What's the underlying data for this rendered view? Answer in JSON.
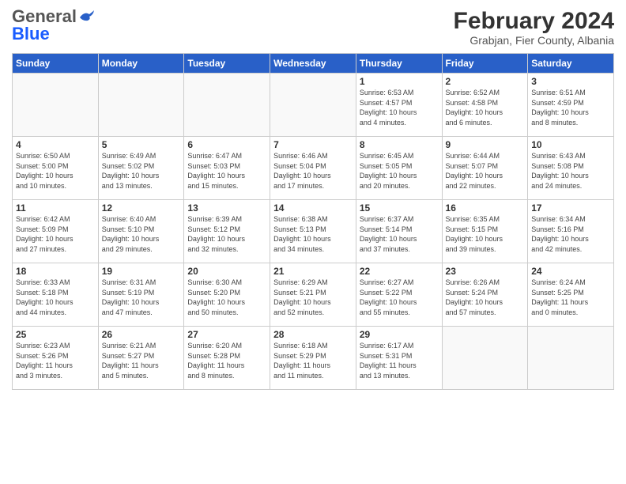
{
  "header": {
    "logo_general": "General",
    "logo_blue": "Blue",
    "title": "February 2024",
    "location": "Grabjan, Fier County, Albania"
  },
  "days_of_week": [
    "Sunday",
    "Monday",
    "Tuesday",
    "Wednesday",
    "Thursday",
    "Friday",
    "Saturday"
  ],
  "weeks": [
    [
      {
        "day": "",
        "info": ""
      },
      {
        "day": "",
        "info": ""
      },
      {
        "day": "",
        "info": ""
      },
      {
        "day": "",
        "info": ""
      },
      {
        "day": "1",
        "info": "Sunrise: 6:53 AM\nSunset: 4:57 PM\nDaylight: 10 hours\nand 4 minutes."
      },
      {
        "day": "2",
        "info": "Sunrise: 6:52 AM\nSunset: 4:58 PM\nDaylight: 10 hours\nand 6 minutes."
      },
      {
        "day": "3",
        "info": "Sunrise: 6:51 AM\nSunset: 4:59 PM\nDaylight: 10 hours\nand 8 minutes."
      }
    ],
    [
      {
        "day": "4",
        "info": "Sunrise: 6:50 AM\nSunset: 5:00 PM\nDaylight: 10 hours\nand 10 minutes."
      },
      {
        "day": "5",
        "info": "Sunrise: 6:49 AM\nSunset: 5:02 PM\nDaylight: 10 hours\nand 13 minutes."
      },
      {
        "day": "6",
        "info": "Sunrise: 6:47 AM\nSunset: 5:03 PM\nDaylight: 10 hours\nand 15 minutes."
      },
      {
        "day": "7",
        "info": "Sunrise: 6:46 AM\nSunset: 5:04 PM\nDaylight: 10 hours\nand 17 minutes."
      },
      {
        "day": "8",
        "info": "Sunrise: 6:45 AM\nSunset: 5:05 PM\nDaylight: 10 hours\nand 20 minutes."
      },
      {
        "day": "9",
        "info": "Sunrise: 6:44 AM\nSunset: 5:07 PM\nDaylight: 10 hours\nand 22 minutes."
      },
      {
        "day": "10",
        "info": "Sunrise: 6:43 AM\nSunset: 5:08 PM\nDaylight: 10 hours\nand 24 minutes."
      }
    ],
    [
      {
        "day": "11",
        "info": "Sunrise: 6:42 AM\nSunset: 5:09 PM\nDaylight: 10 hours\nand 27 minutes."
      },
      {
        "day": "12",
        "info": "Sunrise: 6:40 AM\nSunset: 5:10 PM\nDaylight: 10 hours\nand 29 minutes."
      },
      {
        "day": "13",
        "info": "Sunrise: 6:39 AM\nSunset: 5:12 PM\nDaylight: 10 hours\nand 32 minutes."
      },
      {
        "day": "14",
        "info": "Sunrise: 6:38 AM\nSunset: 5:13 PM\nDaylight: 10 hours\nand 34 minutes."
      },
      {
        "day": "15",
        "info": "Sunrise: 6:37 AM\nSunset: 5:14 PM\nDaylight: 10 hours\nand 37 minutes."
      },
      {
        "day": "16",
        "info": "Sunrise: 6:35 AM\nSunset: 5:15 PM\nDaylight: 10 hours\nand 39 minutes."
      },
      {
        "day": "17",
        "info": "Sunrise: 6:34 AM\nSunset: 5:16 PM\nDaylight: 10 hours\nand 42 minutes."
      }
    ],
    [
      {
        "day": "18",
        "info": "Sunrise: 6:33 AM\nSunset: 5:18 PM\nDaylight: 10 hours\nand 44 minutes."
      },
      {
        "day": "19",
        "info": "Sunrise: 6:31 AM\nSunset: 5:19 PM\nDaylight: 10 hours\nand 47 minutes."
      },
      {
        "day": "20",
        "info": "Sunrise: 6:30 AM\nSunset: 5:20 PM\nDaylight: 10 hours\nand 50 minutes."
      },
      {
        "day": "21",
        "info": "Sunrise: 6:29 AM\nSunset: 5:21 PM\nDaylight: 10 hours\nand 52 minutes."
      },
      {
        "day": "22",
        "info": "Sunrise: 6:27 AM\nSunset: 5:22 PM\nDaylight: 10 hours\nand 55 minutes."
      },
      {
        "day": "23",
        "info": "Sunrise: 6:26 AM\nSunset: 5:24 PM\nDaylight: 10 hours\nand 57 minutes."
      },
      {
        "day": "24",
        "info": "Sunrise: 6:24 AM\nSunset: 5:25 PM\nDaylight: 11 hours\nand 0 minutes."
      }
    ],
    [
      {
        "day": "25",
        "info": "Sunrise: 6:23 AM\nSunset: 5:26 PM\nDaylight: 11 hours\nand 3 minutes."
      },
      {
        "day": "26",
        "info": "Sunrise: 6:21 AM\nSunset: 5:27 PM\nDaylight: 11 hours\nand 5 minutes."
      },
      {
        "day": "27",
        "info": "Sunrise: 6:20 AM\nSunset: 5:28 PM\nDaylight: 11 hours\nand 8 minutes."
      },
      {
        "day": "28",
        "info": "Sunrise: 6:18 AM\nSunset: 5:29 PM\nDaylight: 11 hours\nand 11 minutes."
      },
      {
        "day": "29",
        "info": "Sunrise: 6:17 AM\nSunset: 5:31 PM\nDaylight: 11 hours\nand 13 minutes."
      },
      {
        "day": "",
        "info": ""
      },
      {
        "day": "",
        "info": ""
      }
    ]
  ]
}
